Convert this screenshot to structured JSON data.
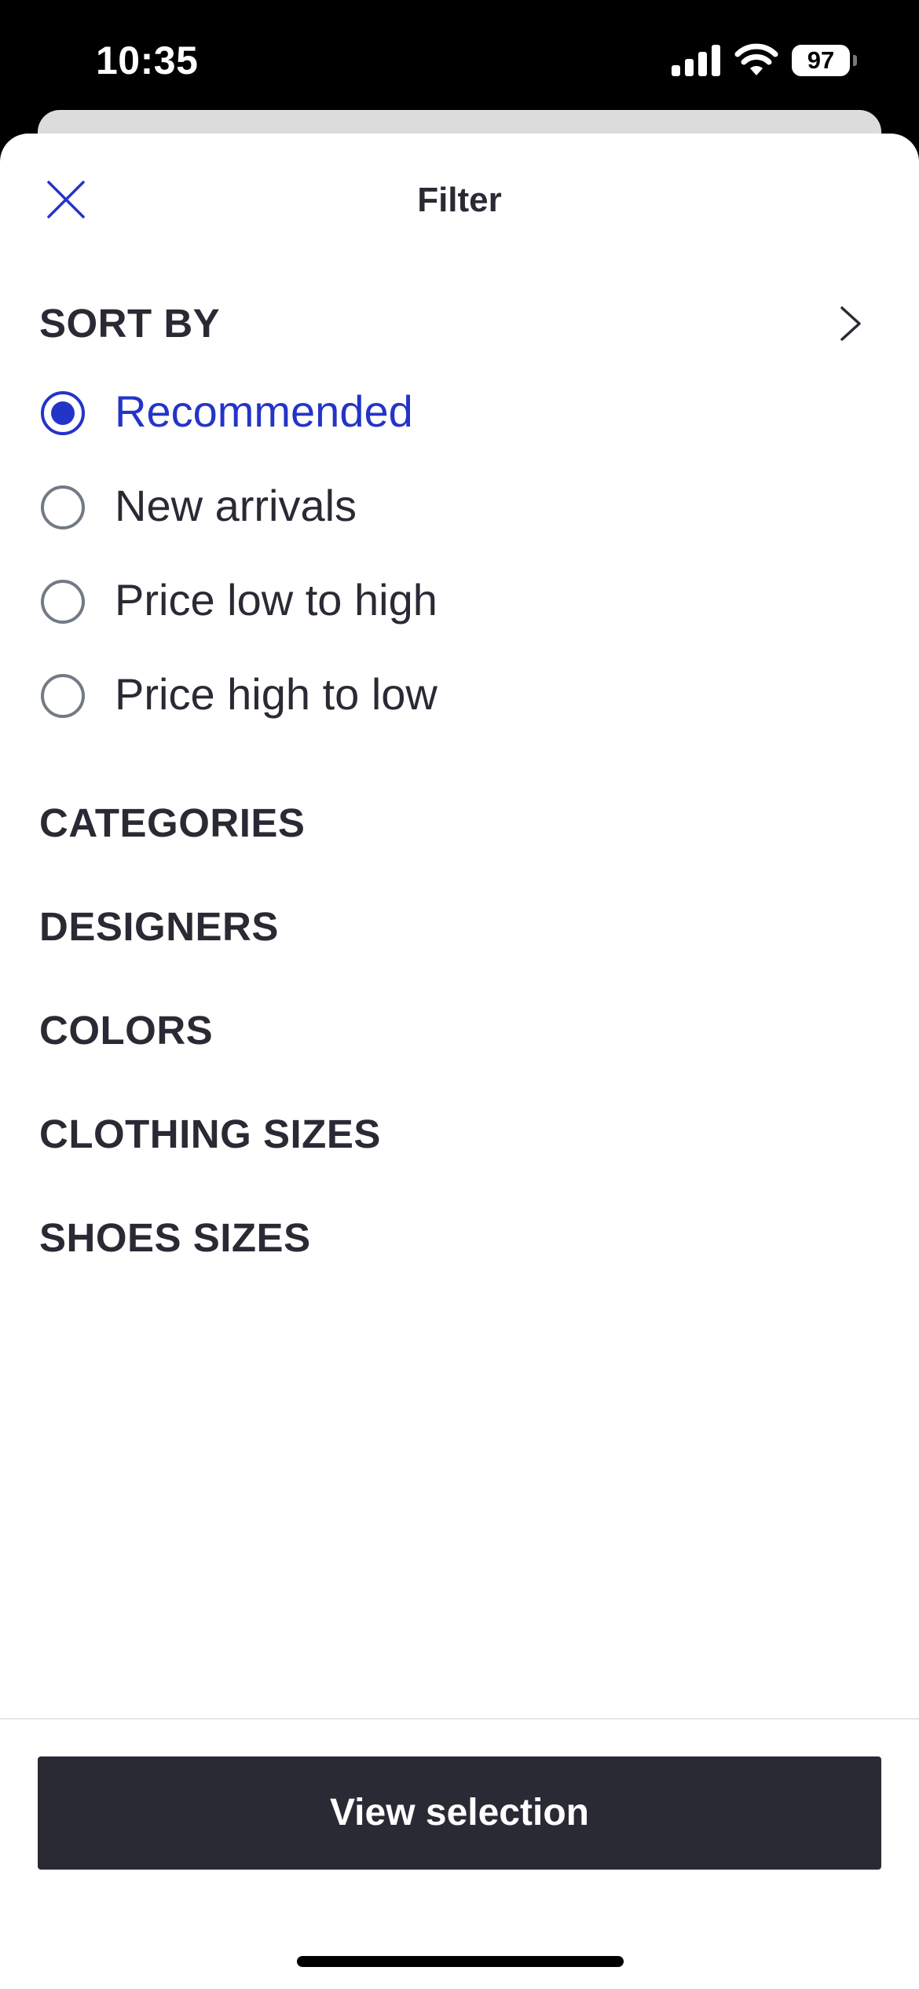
{
  "status_bar": {
    "time": "10:35",
    "battery": "97"
  },
  "sheet": {
    "title": "Filter"
  },
  "sort": {
    "header": "SORT BY",
    "options": [
      {
        "label": "Recommended",
        "selected": true
      },
      {
        "label": "New arrivals",
        "selected": false
      },
      {
        "label": "Price low to high",
        "selected": false
      },
      {
        "label": "Price high to low",
        "selected": false
      }
    ]
  },
  "sections": [
    "CATEGORIES",
    "DESIGNERS",
    "COLORS",
    "CLOTHING SIZES",
    "SHOES SIZES"
  ],
  "footer": {
    "button_label": "View selection"
  },
  "colors": {
    "accent": "#2434c8",
    "text": "#2a2a35",
    "button": "#2a2a35"
  },
  "icons": [
    "close-icon",
    "chevron-right-icon",
    "signal-icon",
    "wifi-icon",
    "battery-icon"
  ]
}
